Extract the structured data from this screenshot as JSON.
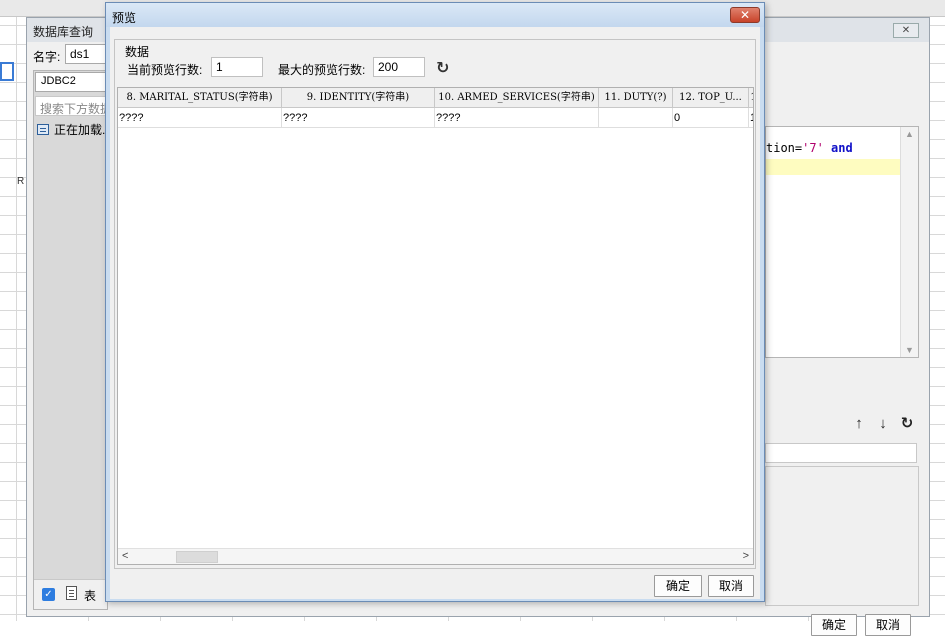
{
  "db_dialog": {
    "title": "数据库查询",
    "close_glyph": "✕",
    "name_label": "名字:",
    "name_value": "ds1",
    "connection": "JDBC2",
    "search_placeholder": "搜索下方数据",
    "loading_text": "正在加载...",
    "table_checkbox_label": "表",
    "sql": {
      "prefix": "tion=",
      "string_literal": "'7'",
      "keyword": "and"
    },
    "param_tools": {
      "up": "↑",
      "down": "↓",
      "refresh": "↻"
    },
    "ok_label": "确定",
    "cancel_label": "取消"
  },
  "preview_dialog": {
    "title": "预览",
    "close_glyph": "✕",
    "group_label": "数据",
    "current_rows_label": "当前预览行数:",
    "current_rows_value": "1",
    "max_rows_label": "最大的预览行数:",
    "max_rows_value": "200",
    "refresh_glyph": "↻",
    "columns": [
      "8. MARITAL_STATUS(字符串)",
      "9. IDENTITY(字符串)",
      "10. ARMED_SERVICES(字符串)",
      "11. DUTY(?)",
      "12. TOP_U...",
      "1"
    ],
    "rows": [
      [
        "????",
        "????",
        "????",
        "",
        "0",
        "1"
      ]
    ],
    "scroll_left": "<",
    "scroll_right": ">",
    "ok_label": "确定",
    "cancel_label": "取消"
  },
  "sheet": {
    "stray_text": "R"
  }
}
